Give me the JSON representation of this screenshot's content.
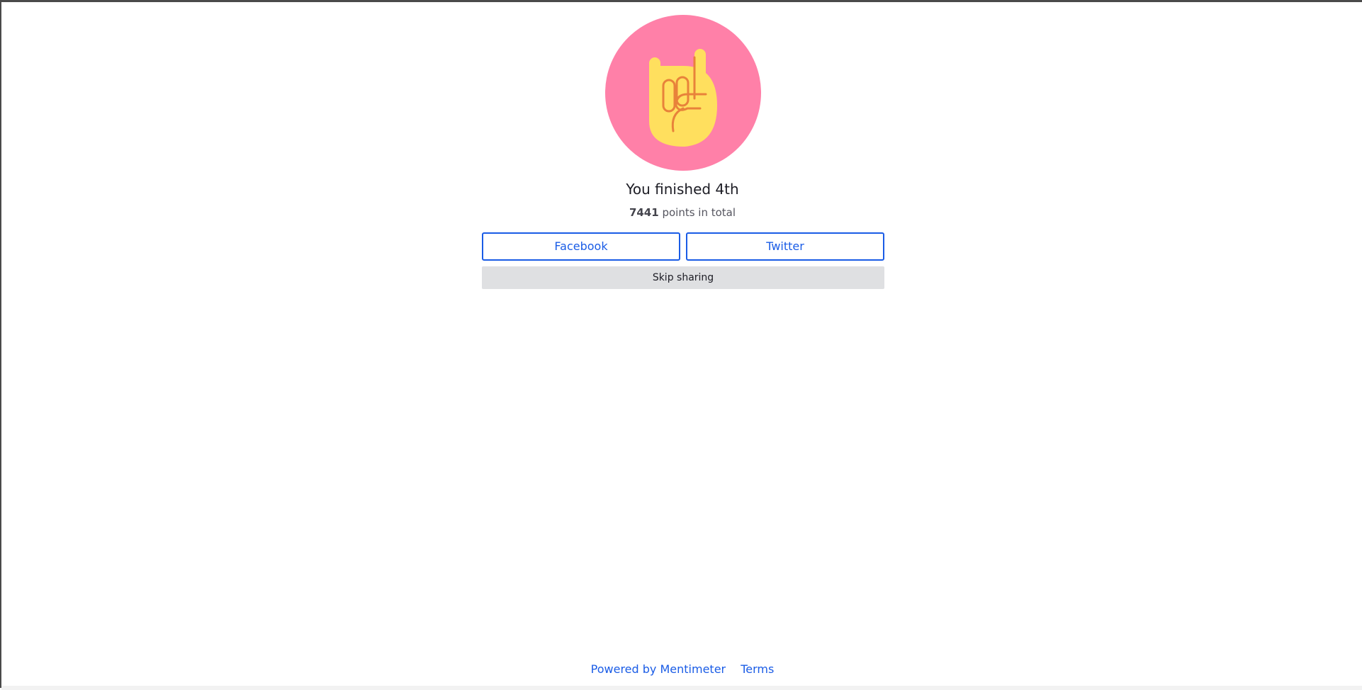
{
  "result": {
    "title": "You finished 4th",
    "points": "7441",
    "points_suffix": " points in total"
  },
  "avatar": {
    "icon": "rock-hand-icon",
    "background": "#ff80a8",
    "hand_color": "#ffdf5e",
    "line_color": "#e8823a"
  },
  "share": {
    "facebook_label": "Facebook",
    "twitter_label": "Twitter",
    "skip_label": "Skip sharing"
  },
  "footer": {
    "powered_label": "Powered by Mentimeter",
    "terms_label": "Terms"
  },
  "colors": {
    "accent": "#1a5ce6",
    "skip_bg": "#dfe0e2"
  }
}
